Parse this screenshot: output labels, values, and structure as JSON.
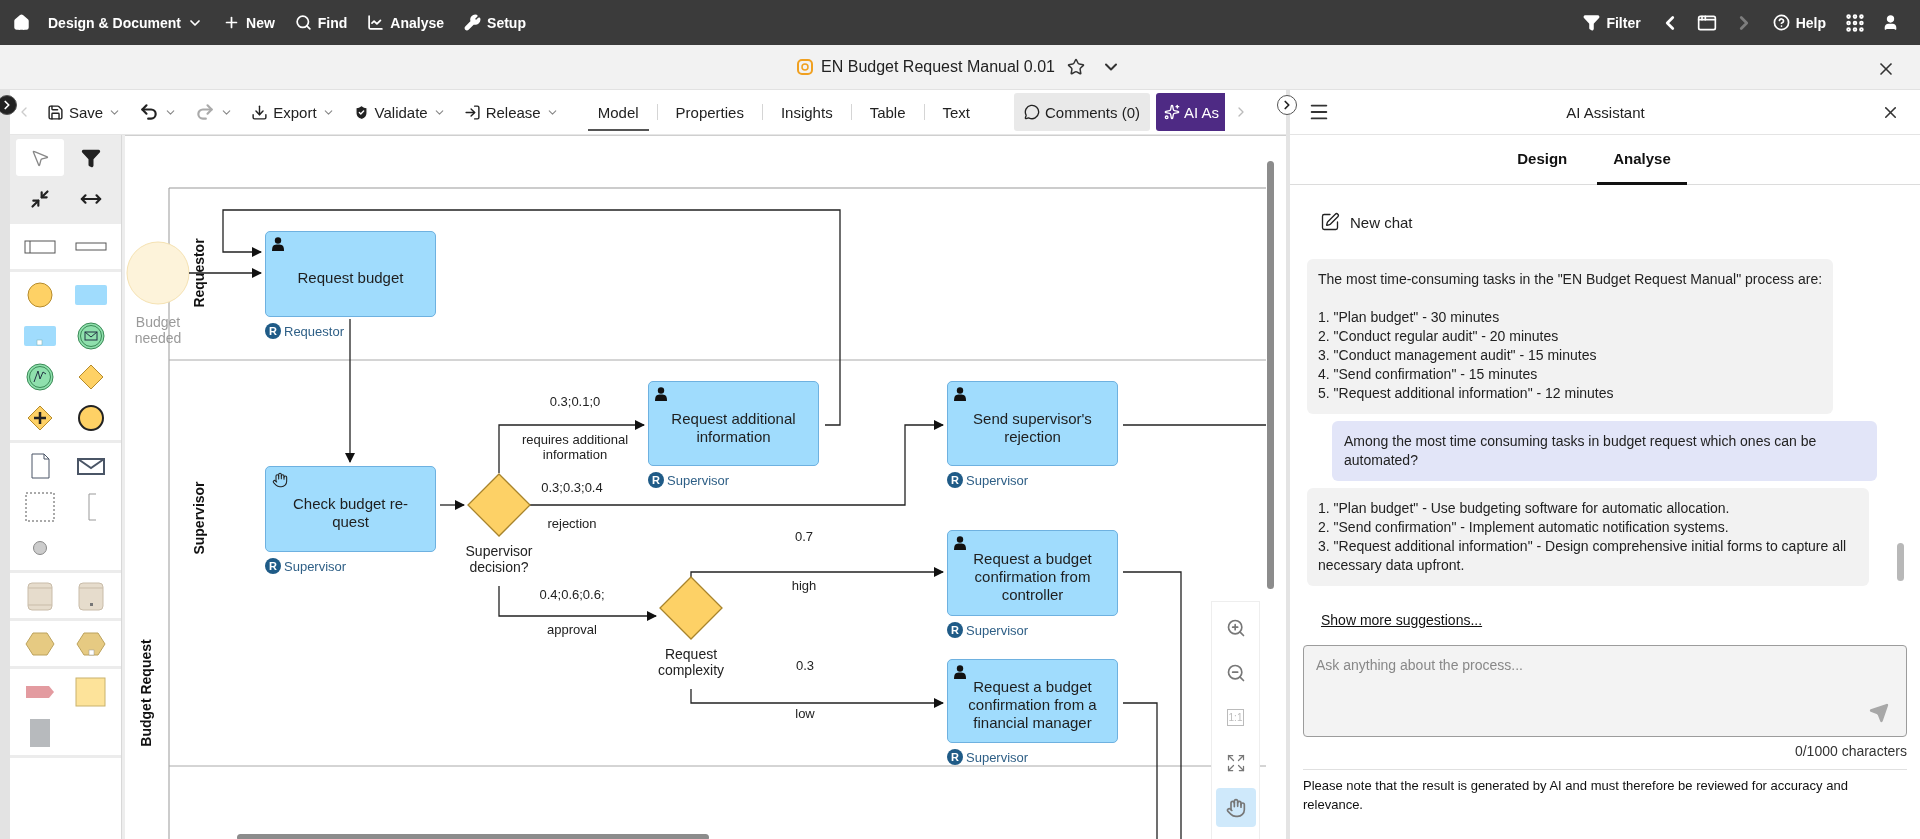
{
  "top_nav": {
    "menu": [
      {
        "kind": "home"
      },
      {
        "kind": "dropdown",
        "label": "Design & Document"
      },
      {
        "kind": "new",
        "label": "New"
      },
      {
        "kind": "find",
        "label": "Find"
      },
      {
        "kind": "analyse",
        "label": "Analyse"
      },
      {
        "kind": "setup",
        "label": "Setup"
      }
    ],
    "right": [
      {
        "kind": "filter",
        "label": "Filter",
        "disabled": false
      },
      {
        "kind": "back",
        "disabled": false
      },
      {
        "kind": "window",
        "disabled": false
      },
      {
        "kind": "forward",
        "disabled": true
      },
      {
        "kind": "help",
        "label": "Help",
        "disabled": false
      },
      {
        "kind": "apps",
        "disabled": false
      },
      {
        "kind": "user",
        "disabled": false
      }
    ]
  },
  "document": {
    "title": "EN Budget Request Manual 0.01",
    "favorite": false
  },
  "toolbar": {
    "actions": [
      {
        "kind": "save",
        "label": "Save",
        "disabled": false
      },
      {
        "kind": "undo",
        "disabled": false
      },
      {
        "kind": "redo",
        "disabled": true
      },
      {
        "kind": "export",
        "label": "Export",
        "disabled": false
      },
      {
        "kind": "validate",
        "label": "Validate",
        "disabled": false
      },
      {
        "kind": "release",
        "label": "Release",
        "disabled": false
      }
    ],
    "view_tabs": [
      {
        "label": "Model",
        "selected": true
      },
      {
        "label": "Properties",
        "selected": false
      },
      {
        "label": "Insights",
        "selected": false
      },
      {
        "label": "Table",
        "selected": false
      },
      {
        "label": "Text",
        "selected": false
      }
    ],
    "comments": "Comments (0)",
    "ai_button": "AI As"
  },
  "palette": {
    "tools": [
      {
        "selected": true
      },
      {
        "selected": false
      },
      {
        "selected": false
      },
      {
        "selected": false
      }
    ]
  },
  "diagram": {
    "pool": "Budget Request",
    "lanes": [
      "Requestor",
      "Supervisor"
    ],
    "start_event": "Budget needed",
    "tasks": [
      {
        "label": "Request budget",
        "kind": "user",
        "role_badge": "R",
        "role": "Requestor"
      },
      {
        "label": "Check budget re-quest",
        "kind": "manual",
        "role_badge": "R",
        "role": "Supervisor"
      },
      {
        "label": "Request additional information",
        "kind": "user",
        "role_badge": "R",
        "role": "Supervisor"
      },
      {
        "label": "Send supervisor's rejection",
        "kind": "user",
        "role_badge": "R",
        "role": "Supervisor"
      },
      {
        "label": "Request a budget confirmation from controller",
        "kind": "user",
        "role_badge": "R",
        "role": "Supervisor"
      },
      {
        "label": "Request a budget confirmation from a financial manager",
        "kind": "user",
        "role_badge": "R",
        "role": "Supervisor"
      }
    ],
    "gateways": [
      "Supervisor decision?",
      "Request complexity"
    ],
    "flow_labels": [
      "0.3;0.1;0",
      "requires additional information",
      "0.3;0.3;0.4",
      "rejection",
      "0.7",
      "high",
      "0.4;0.6;0.6;",
      "approval",
      "0.3",
      "low"
    ]
  },
  "canvas_tools": [
    {
      "kind": "zoom-in",
      "selected": false
    },
    {
      "kind": "zoom-out",
      "selected": false
    },
    {
      "kind": "actual-size",
      "label": "1:1",
      "selected": false
    },
    {
      "kind": "fit-page",
      "selected": false
    },
    {
      "kind": "hand",
      "selected": true
    }
  ],
  "ai_panel": {
    "title": "AI Assistant",
    "tabs": [
      {
        "label": "Design",
        "selected": false
      },
      {
        "label": "Analyse",
        "selected": true
      }
    ],
    "new_chat": "New chat",
    "messages": [
      {
        "kind": "assistant",
        "intro": "The most time-consuming tasks in the \"EN Budget Request Manual\" process are:",
        "items": [
          "1. \"Plan budget\" - 30 minutes",
          "2. \"Conduct regular audit\" - 20 minutes",
          "3. \"Conduct management audit\" - 15 minutes",
          "4. \"Send confirmation\" - 15 minutes",
          "5. \"Request additional information\" - 12 minutes"
        ]
      },
      {
        "kind": "user",
        "intro": "Among the most time consuming tasks in budget request which ones can be automated?"
      },
      {
        "kind": "assistant",
        "items": [
          "1. \"Plan budget\" - Use budgeting software for automatic allocation.",
          "2. \"Send confirmation\" - Implement automatic notification systems.",
          "3. \"Request additional information\" - Design comprehensive initial forms to capture all necessary data upfront."
        ]
      }
    ],
    "show_more": "Show more suggestions...",
    "input": {
      "placeholder": "Ask anything about the process..."
    },
    "char_count": "0/1000 characters",
    "disclaimer": "Please note that the result is generated by AI and must therefore be reviewed for accuracy and relevance."
  }
}
